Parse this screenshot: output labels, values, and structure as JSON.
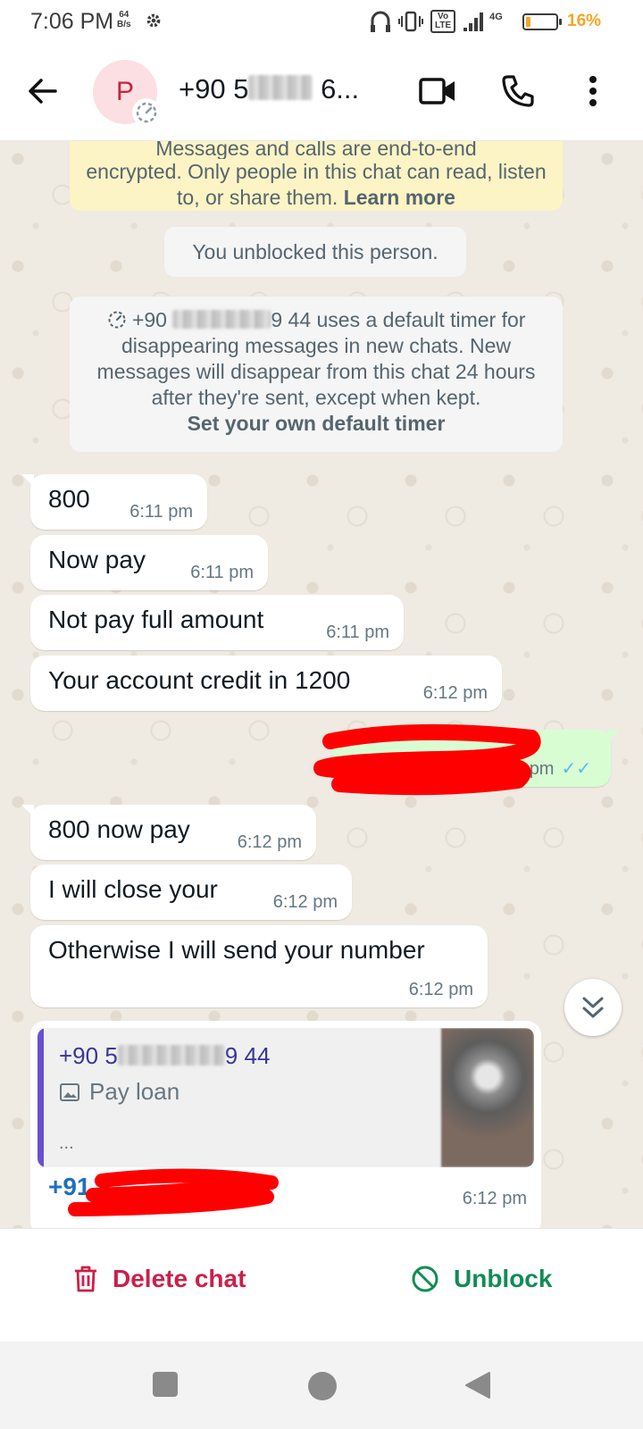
{
  "status_bar": {
    "time": "7:06 PM",
    "net_speed_value": "64",
    "net_speed_unit": "B/s",
    "battery_percent_label": "16%",
    "battery_level": 0.16,
    "network_labels": [
      "Vo",
      "LTE",
      "4G"
    ]
  },
  "header": {
    "avatar_letter": "P",
    "contact_prefix": "+90 5",
    "contact_suffix": " 6...",
    "icons": [
      "back-arrow-icon",
      "video-call-icon",
      "voice-call-icon",
      "more-options-icon"
    ]
  },
  "system_messages": {
    "encryption_partial": "Messages and calls are end-to-end",
    "encryption_text": "encrypted. Only people in this chat can read, listen to, or share them.",
    "learn_more": "Learn more",
    "unblocked": "You unblocked this person.",
    "timer_prefix": "+90",
    "timer_suffix": "9 44 uses a default timer for",
    "timer_text": "disappearing messages in new chats. New messages will disappear from this chat 24 hours after they're sent, except when kept.",
    "timer_link": "Set your own default timer"
  },
  "messages": [
    {
      "text": "800",
      "time": "6:11 pm"
    },
    {
      "text": "Now pay",
      "time": "6:11 pm"
    },
    {
      "text": "Not pay full amount",
      "time": "6:11 pm"
    },
    {
      "text": "Your account credit in 1200",
      "time": "6:12 pm"
    },
    {
      "text": "",
      "time": "pm"
    },
    {
      "text": "800 now pay",
      "time": "6:12 pm"
    },
    {
      "text": "I will close your",
      "time": "6:12 pm"
    },
    {
      "text": "Otherwise I will send your number",
      "time": "6:12 pm"
    }
  ],
  "reply_message": {
    "quoted_sender_prefix": "+90 5",
    "quoted_sender_suffix": "9 44",
    "quoted_text": "Pay loan",
    "quoted_more": "...",
    "link_prefix": "+91",
    "time": "6:12 pm"
  },
  "actions": {
    "delete_label": "Delete chat",
    "unblock_label": "Unblock"
  }
}
